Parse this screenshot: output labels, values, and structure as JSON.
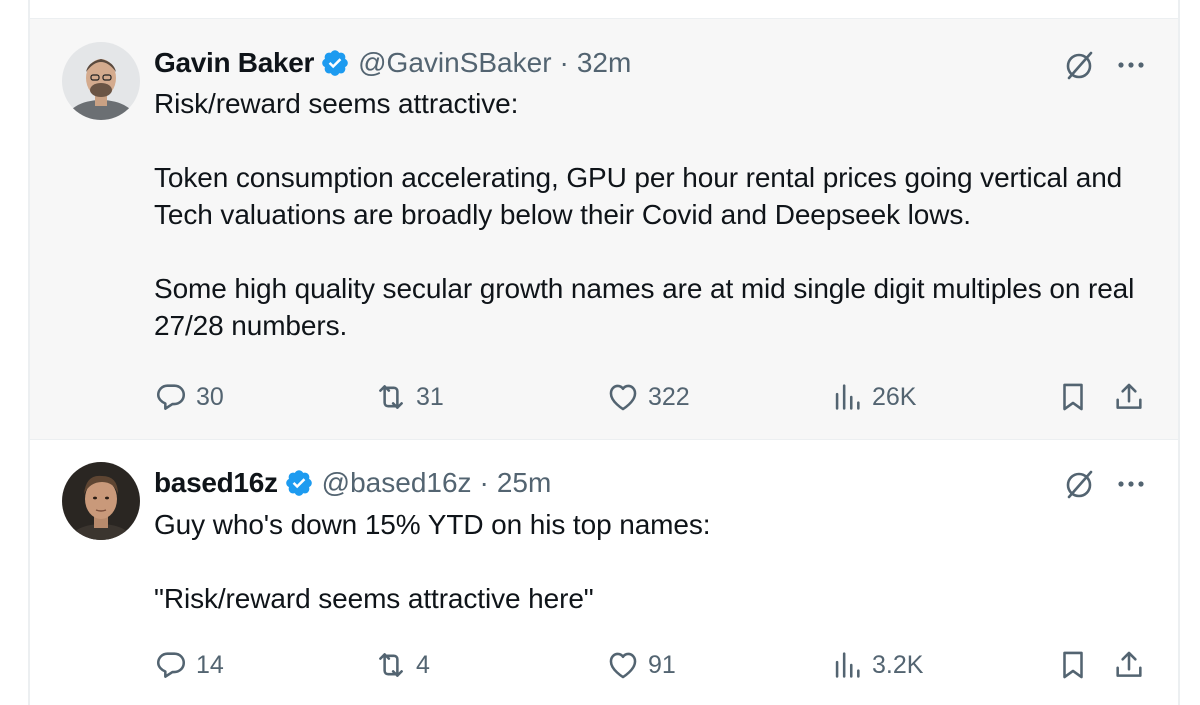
{
  "tweets": [
    {
      "author_name": "Gavin Baker",
      "handle": "@GavinSBaker",
      "separator": "·",
      "time": "32m",
      "verified": true,
      "paragraphs": [
        "Risk/reward seems attractive:",
        "Token consumption accelerating, GPU per hour rental prices going vertical and Tech valuations are broadly below their Covid and Deepseek lows.",
        "Some high quality secular growth names are at mid single digit multiples on real 27/28 numbers."
      ],
      "stats": {
        "replies": "30",
        "reposts": "31",
        "likes": "322",
        "views": "26K"
      }
    },
    {
      "author_name": "based16z",
      "handle": "@based16z",
      "separator": "·",
      "time": "25m",
      "verified": true,
      "paragraphs": [
        "Guy who's down 15% YTD on his top names:",
        "\"Risk/reward seems attractive here\""
      ],
      "stats": {
        "replies": "14",
        "reposts": "4",
        "likes": "91",
        "views": "3.2K"
      }
    }
  ],
  "icons": {
    "verified": "verified-badge-icon",
    "grok": "grok-icon",
    "more": "more-icon",
    "reply": "reply-icon",
    "repost": "repost-icon",
    "like": "like-icon",
    "views": "views-icon",
    "bookmark": "bookmark-icon",
    "share": "share-icon"
  },
  "colors": {
    "verified_blue": "#1d9bf0",
    "text_primary": "#0f1419",
    "text_secondary": "#536471",
    "highlight_bg": "#f7f7f7"
  }
}
